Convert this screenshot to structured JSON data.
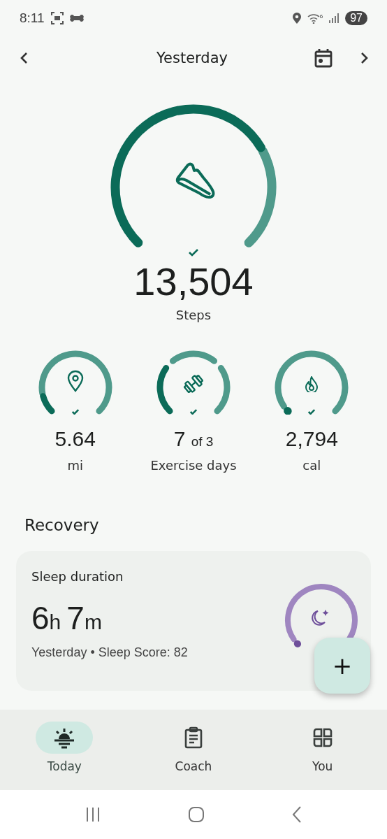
{
  "status_bar": {
    "time": "8:11",
    "wifi_label": "6",
    "battery": "97"
  },
  "header": {
    "title": "Yesterday"
  },
  "steps": {
    "goal_met": true,
    "value": "13,504",
    "label": "Steps"
  },
  "metrics": [
    {
      "kind": "ring",
      "goal_met": true,
      "value": "5.64",
      "label": "mi"
    },
    {
      "kind": "segmented",
      "goal_met": true,
      "value": "7",
      "suffix": "of 3",
      "label": "Exercise days"
    },
    {
      "kind": "ring",
      "goal_met": true,
      "value": "2,794",
      "label": "cal"
    }
  ],
  "section_title": "Recovery",
  "sleep_card": {
    "title": "Sleep duration",
    "duration": [
      {
        "number": "6",
        "unit": "h"
      },
      {
        "number": "7",
        "unit": "m"
      }
    ],
    "subtitle": "Yesterday • Sleep Score: 82"
  },
  "fab": {
    "label": "+"
  },
  "nav": [
    {
      "label": "Today",
      "selected": true
    },
    {
      "label": "Coach",
      "selected": false
    },
    {
      "label": "You",
      "selected": false
    }
  ]
}
